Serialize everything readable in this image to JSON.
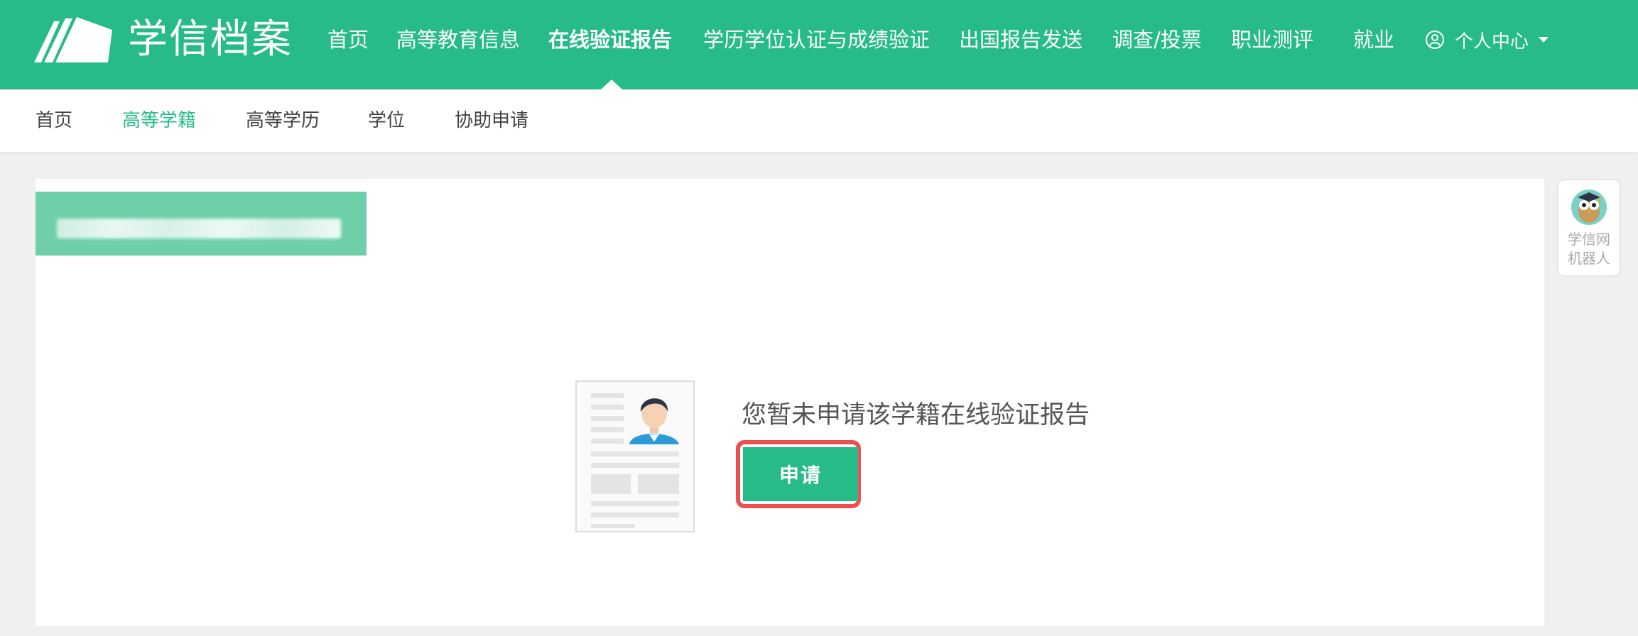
{
  "brand": {
    "name": "学信档案",
    "primary_color": "#26bb87",
    "highlight_color": "#e9504f"
  },
  "topnav": {
    "items": [
      {
        "label": "首页"
      },
      {
        "label": "高等教育信息"
      },
      {
        "label": "在线验证报告",
        "active": true
      },
      {
        "label": "学历学位认证与成绩验证"
      },
      {
        "label": "出国报告发送"
      },
      {
        "label": "调查/投票"
      },
      {
        "label": "职业测评"
      },
      {
        "label": "就业"
      }
    ],
    "user_menu": {
      "label": "个人中心",
      "icon": "user-circle-icon"
    }
  },
  "subnav": {
    "items": [
      {
        "label": "首页"
      },
      {
        "label": "高等学籍",
        "active": true
      },
      {
        "label": "高等学历"
      },
      {
        "label": "学位"
      },
      {
        "label": "协助申请"
      }
    ]
  },
  "content": {
    "empty_message": "您暂未申请该学籍在线验证报告",
    "apply_button": "申请"
  },
  "robot_widget": {
    "label": "学信网\n机器人",
    "icon": "owl-robot-icon"
  }
}
